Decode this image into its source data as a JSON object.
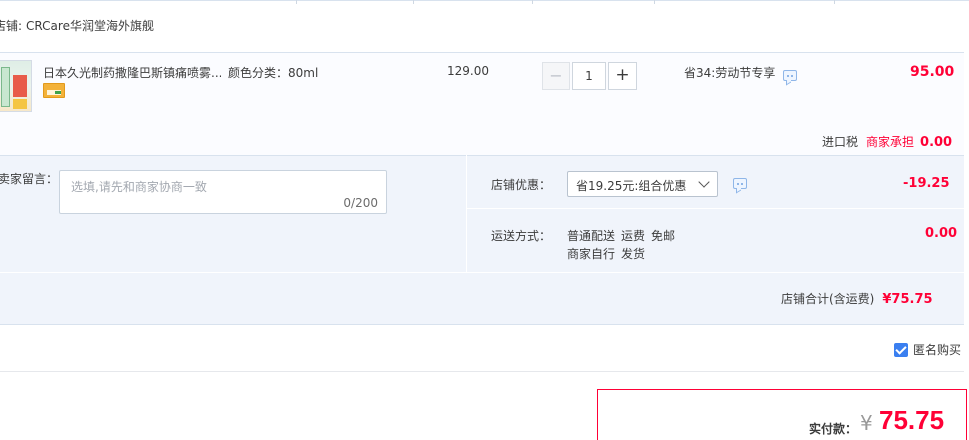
{
  "shop": {
    "label": "店铺:",
    "name": "CRCare华润堂海外旗舰"
  },
  "item": {
    "title": "日本久光制药撒隆巴斯镇痛喷雾...",
    "spec_label": "颜色分类：",
    "spec_value": "80ml",
    "unit_price": "129.00",
    "quantity": "1",
    "promo": "省34:劳动节专享",
    "total": "95.00",
    "thumb_icon": "product-thumbnail",
    "badge_icon": "cross-border-badge-icon"
  },
  "tax": {
    "label": "进口税",
    "who": "商家承担",
    "value": "0.00"
  },
  "seller_note": {
    "label": "卖家留言：",
    "placeholder": "选填,请先和商家协商一致",
    "counter": "0/200"
  },
  "discount": {
    "label": "店铺优惠：",
    "selected": "省19.25元:组合优惠",
    "value": "-19.25"
  },
  "shipping": {
    "label": "运送方式：",
    "method": "普通配送",
    "fee_label": "运费",
    "fee_value": "免邮",
    "seller": "商家自行",
    "dispatch": "发货",
    "value": "0.00"
  },
  "subtotal": {
    "label": "店铺合计(含运费)",
    "value": "¥75.75"
  },
  "anonymous": {
    "label": "匿名购买",
    "checked": true
  },
  "payment": {
    "label": "实付款：",
    "currency": "¥",
    "amount": "75.75"
  },
  "colors": {
    "price_red": "#ff0036",
    "panel_blue": "#f0f4fb",
    "checkbox_blue": "#3a7ff0"
  }
}
